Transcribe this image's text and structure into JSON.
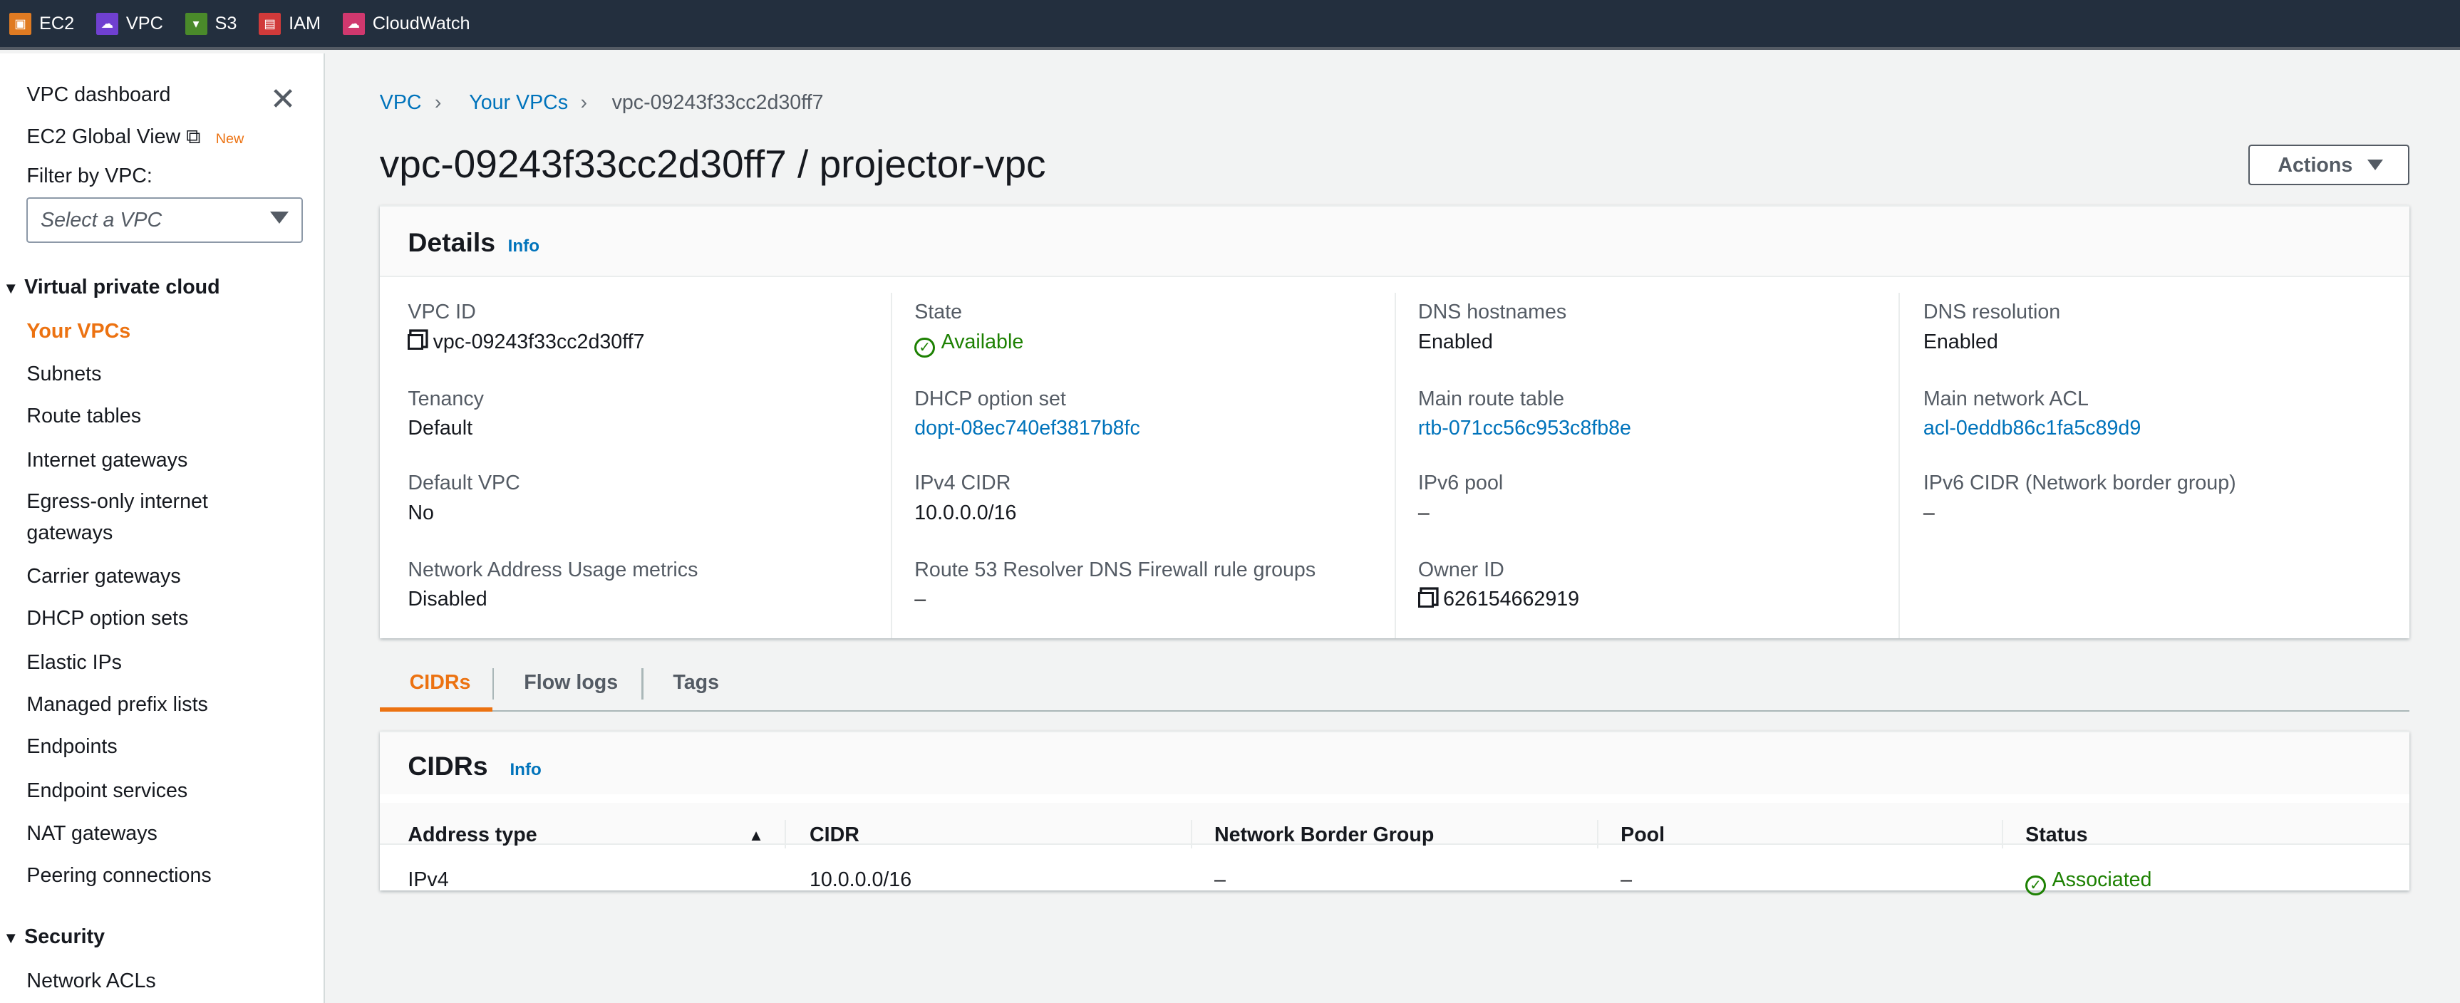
{
  "topbar": {
    "services": [
      {
        "label": "EC2",
        "color": "#e07b22"
      },
      {
        "label": "VPC",
        "color": "#7040d0"
      },
      {
        "label": "S3",
        "color": "#4a8a2a"
      },
      {
        "label": "IAM",
        "color": "#d13a3a"
      },
      {
        "label": "CloudWatch",
        "color": "#d0386e"
      }
    ]
  },
  "sidebar": {
    "dashboard": "VPC dashboard",
    "global_view": "EC2 Global View",
    "new_badge": "New",
    "filter_label": "Filter by VPC:",
    "filter_placeholder": "Select a VPC",
    "section_vpc": "Virtual private cloud",
    "items": [
      "Your VPCs",
      "Subnets",
      "Route tables",
      "Internet gateways",
      "Egress-only internet gateways",
      "Carrier gateways",
      "DHCP option sets",
      "Elastic IPs",
      "Managed prefix lists",
      "Endpoints",
      "Endpoint services",
      "NAT gateways",
      "Peering connections"
    ],
    "section_security": "Security",
    "security_items": [
      "Network ACLs"
    ]
  },
  "breadcrumb": {
    "root": "VPC",
    "parent": "Your VPCs",
    "current": "vpc-09243f33cc2d30ff7"
  },
  "page_title": "vpc-09243f33cc2d30ff7 / projector-vpc",
  "actions_label": "Actions",
  "details": {
    "title": "Details",
    "info": "Info",
    "vpc_id_label": "VPC ID",
    "vpc_id": "vpc-09243f33cc2d30ff7",
    "tenancy_label": "Tenancy",
    "tenancy": "Default",
    "default_vpc_label": "Default VPC",
    "default_vpc": "No",
    "nau_label": "Network Address Usage metrics",
    "nau": "Disabled",
    "state_label": "State",
    "state": "Available",
    "dhcp_label": "DHCP option set",
    "dhcp": "dopt-08ec740ef3817b8fc",
    "ipv4_label": "IPv4 CIDR",
    "ipv4": "10.0.0.0/16",
    "r53_label": "Route 53 Resolver DNS Firewall rule groups",
    "r53": "–",
    "dns_host_label": "DNS hostnames",
    "dns_host": "Enabled",
    "main_rt_label": "Main route table",
    "main_rt": "rtb-071cc56c953c8fb8e",
    "ipv6_pool_label": "IPv6 pool",
    "ipv6_pool": "–",
    "owner_label": "Owner ID",
    "owner": "626154662919",
    "dns_res_label": "DNS resolution",
    "dns_res": "Enabled",
    "acl_label": "Main network ACL",
    "acl": "acl-0eddb86c1fa5c89d9",
    "ipv6_cidr_label": "IPv6 CIDR (Network border group)",
    "ipv6_cidr": "–"
  },
  "tabs": [
    "CIDRs",
    "Flow logs",
    "Tags"
  ],
  "cidrs": {
    "title": "CIDRs",
    "info": "Info",
    "columns": [
      "Address type",
      "CIDR",
      "Network Border Group",
      "Pool",
      "Status"
    ],
    "rows": [
      [
        "IPv4",
        "10.0.0.0/16",
        "–",
        "–",
        "Associated"
      ]
    ]
  }
}
